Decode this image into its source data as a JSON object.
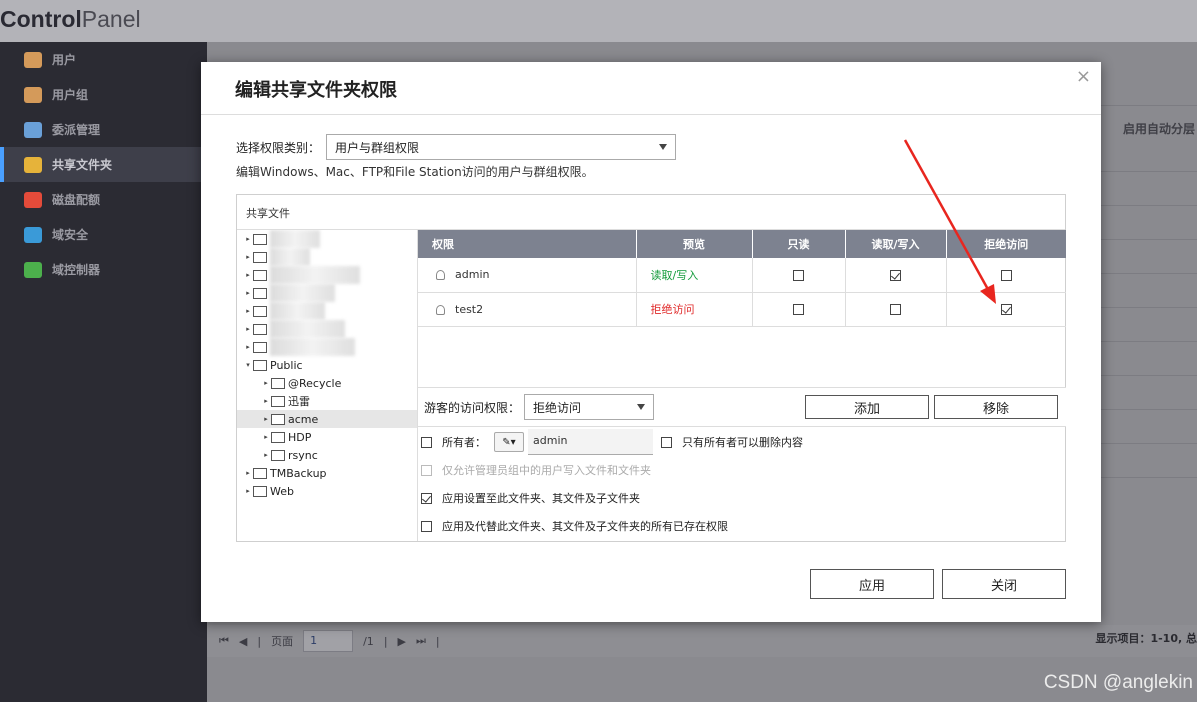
{
  "app": {
    "brand_bold": "Control",
    "brand_light": "Panel"
  },
  "sidebar": {
    "items": [
      {
        "label": "用户",
        "color": "#d49a5a"
      },
      {
        "label": "用户组",
        "color": "#d49a5a"
      },
      {
        "label": "委派管理",
        "color": "#6aa0d8"
      },
      {
        "label": "共享文件夹",
        "color": "#e6b33a"
      },
      {
        "label": "磁盘配额",
        "color": "#e44b3a"
      },
      {
        "label": "域安全",
        "color": "#3a9ad8"
      },
      {
        "label": "域控制器",
        "color": "#4cb04c"
      }
    ]
  },
  "background": {
    "right_label": "启用自动分层",
    "pager_label": "页面",
    "pager_value": "1",
    "pager_total": "/1",
    "pager_right": "显示项目：1-10, 总",
    "watermark": "CSDN @anglekin"
  },
  "dialog": {
    "title": "编辑共享文件夹权限",
    "close": "×",
    "type_label": "选择权限类别：",
    "type_value": "用户与群组权限",
    "description": "编辑Windows、Mac、FTP和File Station访问的用户与群组权限。",
    "panel_title": "共享文件",
    "tree": [
      {
        "label": "",
        "depth": 0,
        "blurred": true
      },
      {
        "label": "",
        "depth": 0,
        "blurred": true
      },
      {
        "label": "",
        "depth": 0,
        "blurred": true
      },
      {
        "label": "",
        "depth": 0,
        "blurred": true
      },
      {
        "label": "",
        "depth": 0,
        "blurred": true
      },
      {
        "label": "",
        "depth": 0,
        "blurred": true
      },
      {
        "label": "",
        "depth": 0,
        "blurred": true
      },
      {
        "label": "Public",
        "depth": 0,
        "open": true
      },
      {
        "label": "@Recycle",
        "depth": 1
      },
      {
        "label": "迅雷",
        "depth": 1
      },
      {
        "label": "acme",
        "depth": 1,
        "selected": true
      },
      {
        "label": "HDP",
        "depth": 1
      },
      {
        "label": "rsync",
        "depth": 1
      },
      {
        "label": "TMBackup",
        "depth": 0
      },
      {
        "label": "Web",
        "depth": 0
      }
    ],
    "columns": [
      "权限",
      "预览",
      "只读",
      "读取/写入",
      "拒绝访问"
    ],
    "rows": [
      {
        "user": "admin",
        "preview": "读取/写入",
        "preview_color": "#129b3a",
        "ro": false,
        "rw": true,
        "deny": false
      },
      {
        "user": "test2",
        "preview": "拒绝访问",
        "preview_color": "#e02a2a",
        "ro": false,
        "rw": false,
        "deny": true
      }
    ],
    "guest_label": "游客的访问权限：",
    "guest_value": "拒绝访问",
    "add_button": "添加",
    "remove_button": "移除",
    "owner_label": "所有者：",
    "owner_value": "admin",
    "owner_only_delete": "只有所有者可以删除内容",
    "admin_write_only": "仅允许管理员组中的用户写入文件和文件夹",
    "apply_to_subfolders": "应用设置至此文件夹、其文件及子文件夹",
    "apply_replace_all": "应用及代替此文件夹、其文件及子文件夹的所有已存在权限",
    "apply_button": "应用",
    "close_button": "关闭"
  },
  "annotation": {
    "arrow_color": "#e8261f"
  }
}
